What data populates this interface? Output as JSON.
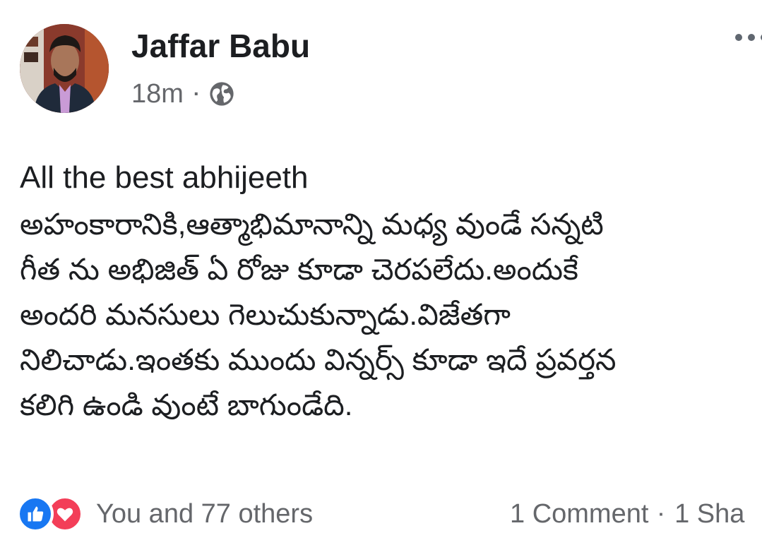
{
  "post": {
    "author": "Jaffar Babu",
    "time": "18m",
    "privacy_icon": "globe-icon",
    "more_icon": "more-options-icon",
    "lines": [
      "All the best abhijeeth",
      "అహంకారానికి,ఆత్మాభిమానాన్ని మధ్య వుండే సన్నటి",
      "గీత ను అభిజిత్ ఏ రోజు కూడా చెరపలేదు.అందుకే",
      "అందరి మనసులు గెలుచుకున్నాడు.విజేతగా",
      "నిలిచాడు.ఇంతకు ముందు విన్నర్స్ కూడా ఇదే ప్రవర్తన",
      "కలిగి ఉండి వుంటే బాగుండేది."
    ],
    "reactions": {
      "icons": [
        "like-icon",
        "love-icon"
      ],
      "text": "You and 77 others"
    },
    "comments": "1 Comment",
    "shares": "1 Sha"
  },
  "colors": {
    "like": "#1877f2",
    "love": "#f33e58",
    "secondary_text": "#65676b"
  }
}
